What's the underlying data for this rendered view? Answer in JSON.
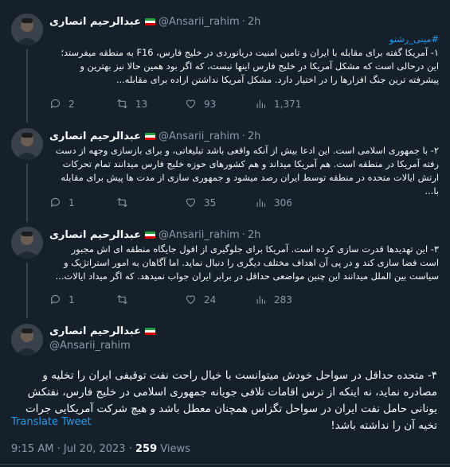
{
  "author": {
    "display_name": "عبدالرحیم انصاری",
    "handle": "@Ansarii_rahim",
    "separator": "·"
  },
  "tweets": [
    {
      "time": "2h",
      "hashtag": "#مینی_رشتو",
      "text": "۱- آمریکا گفته برای مقابله با ایران و تامین امنیت دریانوردی در خلیج فارس، F16 به منطقه میفرستد؛ این درحالی است که مشکل آمریکا در خلیج فارس اینها نیست، که اگر بود همین حالا نیز بهترین و پیشرفته ترین جنگ افزارها را در اختیار دارد. مشکل آمریکا نداشتن اراده برای مقابله...",
      "replies": "2",
      "retweets": "13",
      "likes": "93",
      "views": "1,371"
    },
    {
      "time": "2h",
      "text": "۲- با جمهوری اسلامی است. این ادعا بیش از آنکه واقعی باشد تبلیغاتی، و برای بازسازی وجهه از دست رفته آمریکا در منطقه است. هم آمریکا میداند و هم کشورهای حوزه خلیج فارس میدانند تمام تحرکات ارتش ایالات متحده در منطقه توسط ایران رصد میشود و جمهوری سازی از مدت ها پیش برای مقابله با...",
      "replies": "1",
      "retweets": "",
      "likes": "35",
      "views": "306"
    },
    {
      "time": "2h",
      "text": "۳- این تهدیدها قدرت سازی کرده است. آمریکا برای جلوگیری از افول جایگاه منطقه ای اش مجبور است فضا سازی کند و در پی آن اهداف مختلف دیگری را دنبال نماید. اما آگاهان به امور استراتژیک و سیاست بین الملل میدانند این چنین مواضعی حداقل در برابر ایران جواب نمیدهد. که اگر میداد ایالات...",
      "replies": "1",
      "retweets": "",
      "likes": "24",
      "views": "283"
    }
  ],
  "main_tweet": {
    "text": "۴- متحده حداقل در سواحل خودش میتوانست با خیال راحت نفت توقیفی ایران را تخلیه و مصادره نماید، نه اینکه از ترس اقامات تلافی جویانه جمهوری اسلامی در خلیج فارس، نفتکش یونانی حامل نفت ایران در سواحل تگزاس همچنان معطل باشد و هیچ شرکت آمریکایی جرات تخیه آن را نداشته باشد!",
    "translate_label": "Translate Tweet",
    "time": "9:15 AM",
    "date": "Jul 20, 2023",
    "views_count": "259",
    "views_label": "Views"
  },
  "colors": {
    "background": "#15202b",
    "text": "#f7f9f9",
    "muted": "#8b98a5",
    "accent": "#1d9bf0",
    "divider": "#38444d"
  },
  "icons": [
    "reply-icon",
    "retweet-icon",
    "like-icon",
    "views-icon",
    "flag-iran-icon",
    "avatar"
  ]
}
